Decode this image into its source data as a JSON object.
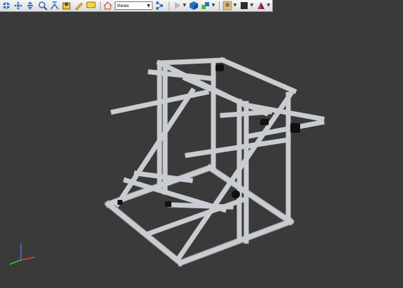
{
  "toolbar": {
    "views_label": "Views",
    "tools": [
      {
        "icon": "orbit-icon"
      },
      {
        "icon": "pan-icon"
      },
      {
        "icon": "fit-view-icon"
      },
      {
        "icon": "zoom-icon"
      },
      {
        "icon": "measure-tool-icon"
      },
      {
        "icon": "section-icon"
      },
      {
        "icon": "markup-pencil-icon"
      },
      {
        "icon": "comment-icon"
      },
      {
        "icon": "home-view-icon"
      },
      {
        "icon": "model-browser-icon"
      },
      {
        "icon": "play-animation-icon"
      },
      {
        "icon": "shaded-cube-icon"
      },
      {
        "icon": "explode-icon"
      },
      {
        "icon": "settings-icon"
      },
      {
        "icon": "background-color-icon"
      },
      {
        "icon": "highlight-icon"
      }
    ]
  },
  "colors": {
    "viewport_bg": "#3a3a3a",
    "frame": "#c9ccd0",
    "frame_shadow": "#8a8d92",
    "axis_x": "#d6442e",
    "axis_y": "#3fbf3f",
    "axis_z": "#4a6fe0"
  }
}
